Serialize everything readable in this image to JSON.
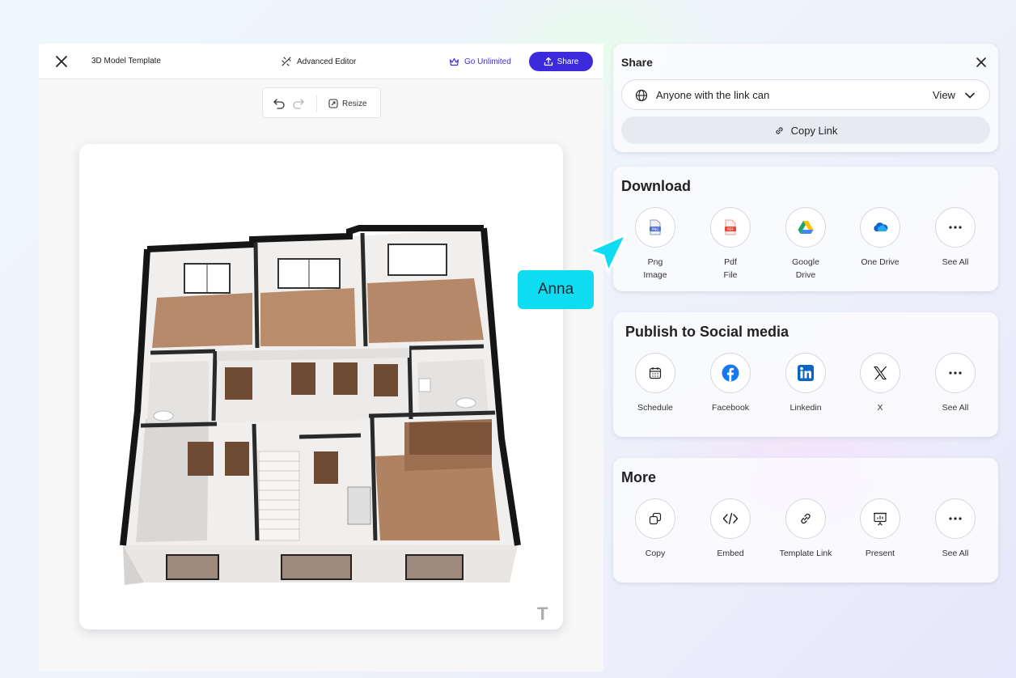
{
  "editor": {
    "title": "3D Model Template",
    "advanced_editor": "Advanced Editor",
    "go_unlimited": "Go Unlimited",
    "share": "Share",
    "resize": "Resize",
    "brand_mark": "T"
  },
  "share_panel": {
    "title": "Share",
    "permission_text": "Anyone with the link can",
    "permission_value": "View",
    "copy_link": "Copy Link"
  },
  "download": {
    "title": "Download",
    "items": [
      {
        "label": "Png\nImage",
        "icon": "png-file-icon"
      },
      {
        "label": "Pdf\nFile",
        "icon": "pdf-file-icon"
      },
      {
        "label": "Google\nDrive",
        "icon": "google-drive-icon"
      },
      {
        "label": "One Drive",
        "icon": "onedrive-icon"
      },
      {
        "label": "See All",
        "icon": "more-dots-icon"
      }
    ]
  },
  "social": {
    "title": "Publish to Social media",
    "items": [
      {
        "label": "Schedule",
        "icon": "calendar-icon"
      },
      {
        "label": "Facebook",
        "icon": "facebook-icon"
      },
      {
        "label": "Linkedin",
        "icon": "linkedin-icon"
      },
      {
        "label": "X",
        "icon": "x-logo-icon"
      },
      {
        "label": "See All",
        "icon": "more-dots-icon"
      }
    ]
  },
  "more": {
    "title": "More",
    "items": [
      {
        "label": "Copy",
        "icon": "copy-icon"
      },
      {
        "label": "Embed",
        "icon": "code-icon"
      },
      {
        "label": "Template Link",
        "icon": "link-icon"
      },
      {
        "label": "Present",
        "icon": "presentation-icon"
      },
      {
        "label": "See All",
        "icon": "more-dots-icon"
      }
    ]
  },
  "collaborator": {
    "name": "Anna",
    "color": "#10dcf1"
  },
  "colors": {
    "accent": "#3b2bdc",
    "go_unlimited": "#3d31d8",
    "facebook": "#1877f2",
    "linkedin": "#0a66c2"
  }
}
